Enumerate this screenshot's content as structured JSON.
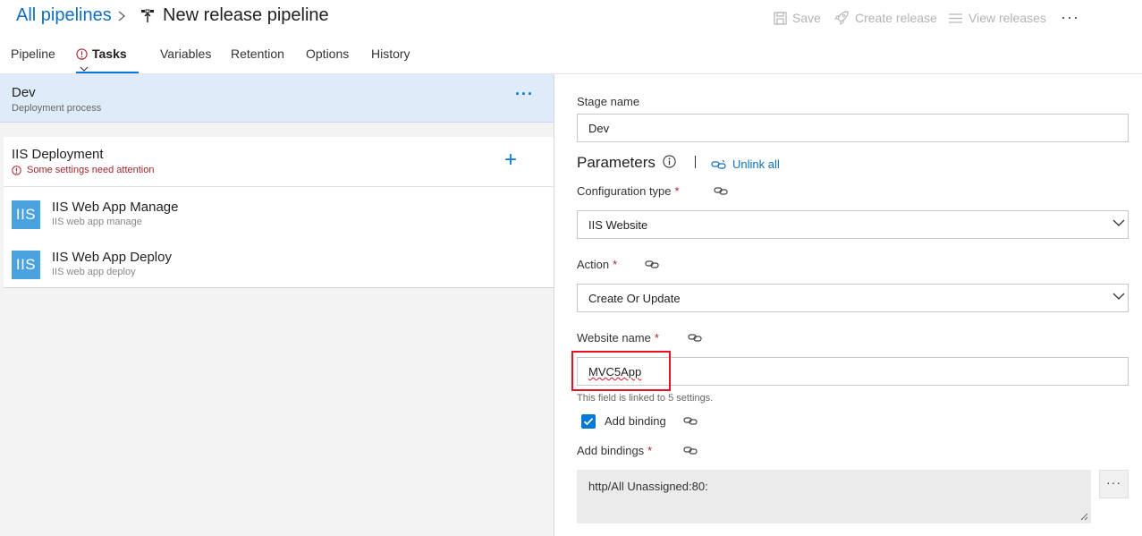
{
  "header": {
    "breadcrumb_root": "All pipelines",
    "title": "New release pipeline",
    "save_label": "Save",
    "create_release_label": "Create release",
    "view_releases_label": "View releases",
    "more_label": "···"
  },
  "tabs": [
    {
      "label": "Pipeline"
    },
    {
      "label": "Tasks"
    },
    {
      "label": "Variables"
    },
    {
      "label": "Retention"
    },
    {
      "label": "Options"
    },
    {
      "label": "History"
    }
  ],
  "stage": {
    "name": "Dev",
    "subtitle": "Deployment process",
    "more_label": "···"
  },
  "job": {
    "name": "IIS Deployment",
    "warning": "Some settings need attention",
    "add_label": "+"
  },
  "tasks": [
    {
      "icon_text": "IIS",
      "name": "IIS Web App Manage",
      "subtitle": "IIS web app manage"
    },
    {
      "icon_text": "IIS",
      "name": "IIS Web App Deploy",
      "subtitle": "IIS web app deploy"
    }
  ],
  "form": {
    "stage_name_label": "Stage name",
    "stage_name_value": "Dev",
    "parameters_label": "Parameters",
    "unlink_all_label": "Unlink all",
    "config_type_label": "Configuration type",
    "config_type_value": "IIS Website",
    "action_label": "Action",
    "action_value": "Create Or Update",
    "website_name_label": "Website name",
    "website_name_value": "MVC5App",
    "linked_hint": "This field is linked to 5 settings.",
    "add_binding_label": "Add binding",
    "add_binding_checked": true,
    "add_bindings_label": "Add bindings",
    "add_bindings_value": "http/All Unassigned:80:",
    "ellipsis_label": "···",
    "required_mark": "*"
  },
  "colors": {
    "accent": "#0078d4",
    "link": "#106ebe",
    "error": "#a4262c",
    "highlight_box": "#e81123",
    "stage_selected_bg": "#deecf9",
    "iis_icon_bg": "#4aa3df"
  }
}
